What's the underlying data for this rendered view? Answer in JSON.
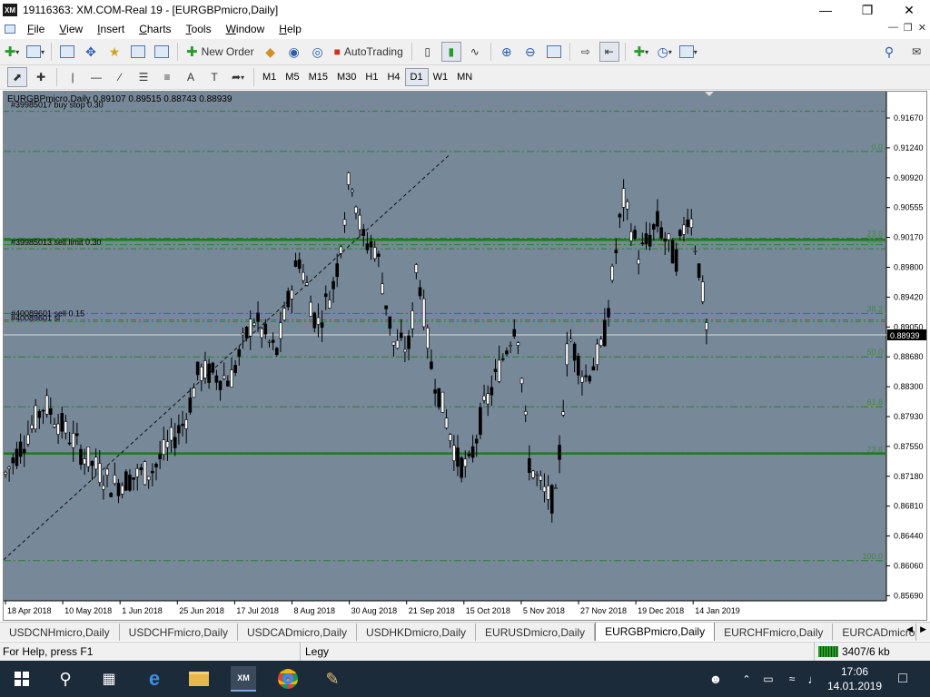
{
  "window": {
    "app_icon": "XM",
    "title": "19116363: XM.COM-Real 19 - [EURGBPmicro,Daily]"
  },
  "menu": [
    "File",
    "View",
    "Insert",
    "Charts",
    "Tools",
    "Window",
    "Help"
  ],
  "toolbar": {
    "new_order": "New Order",
    "autotrading": "AutoTrading"
  },
  "timeframes": [
    "M1",
    "M5",
    "M15",
    "M30",
    "H1",
    "H4",
    "D1",
    "W1",
    "MN"
  ],
  "active_timeframe": "D1",
  "chart": {
    "header": "EURGBPmicro,Daily  0.89107 0.89515 0.88743 0.88939",
    "orders": [
      {
        "label": "#39985017 buy stop 0.30",
        "price": 0.9167
      },
      {
        "label": "#39985013 sell limit 0.30",
        "price": 0.8999
      },
      {
        "label": "#40089601 sell 0.15",
        "price": 0.8912
      },
      {
        "label": "#40089601 sl",
        "price": 0.891
      }
    ],
    "price_ticks": [
      "0.91670",
      "0.91240",
      "0.90920",
      "0.90555",
      "0.90170",
      "0.89800",
      "0.89420",
      "0.89050",
      "0.88680",
      "0.88300",
      "0.87930",
      "0.87550",
      "0.87180",
      "0.86810",
      "0.86440",
      "0.86060",
      "0.85690"
    ],
    "date_ticks": [
      "18 Apr 2018",
      "10 May 2018",
      "1 Jun 2018",
      "25 Jun 2018",
      "17 Jul 2018",
      "8 Aug 2018",
      "30 Aug 2018",
      "21 Sep 2018",
      "15 Oct 2018",
      "5 Nov 2018",
      "27 Nov 2018",
      "19 Dec 2018",
      "14 Jan 2019"
    ],
    "current_price": "0.88939",
    "fib_levels": [
      {
        "label": "0.0",
        "price": 0.9118
      },
      {
        "label": "23.6",
        "price": 0.9012
      },
      {
        "label": "23.6",
        "price": 0.9004
      },
      {
        "label": "38.2",
        "price": 0.892
      },
      {
        "label": "50.0",
        "price": 0.8867
      },
      {
        "label": "61.8",
        "price": 0.8806
      },
      {
        "label": "23.6",
        "price": 0.8748
      },
      {
        "label": "100.0",
        "price": 0.8618
      }
    ],
    "colors": {
      "background": "#778899",
      "grid_line": "#2e7d32",
      "fib_text": "#2e7d32",
      "candle": "#000000",
      "current_price_line": "#dcdcdc"
    }
  },
  "symbol_tabs": [
    "USDCNHmicro,Daily",
    "USDCHFmicro,Daily",
    "USDCADmicro,Daily",
    "USDHKDmicro,Daily",
    "EURUSDmicro,Daily",
    "EURGBPmicro,Daily",
    "EURCHFmicro,Daily",
    "EURCADmicro,"
  ],
  "active_symbol_tab": "EURGBPmicro,Daily",
  "status": {
    "help": "For Help, press F1",
    "profile": "Legy",
    "traffic": "3407/6 kb"
  },
  "taskbar": {
    "time": "17:06",
    "date": "14.01.2019"
  }
}
